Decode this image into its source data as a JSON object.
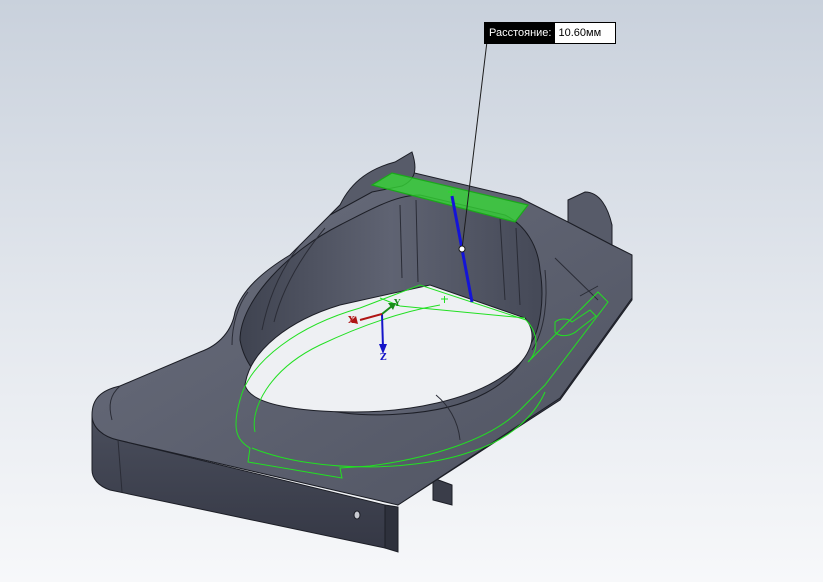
{
  "dimension": {
    "label": "Расстояние:",
    "value": "10.60мм"
  },
  "triad": {
    "x": "X",
    "y": "Y",
    "z": "Z"
  },
  "colors": {
    "background_top": "#c9d1dc",
    "background_bottom": "#f7f8fa",
    "part_top": "#5d6170",
    "part_side": "#3e4250",
    "selection_green": "#22e022",
    "dimension_line": "#1414d8"
  }
}
